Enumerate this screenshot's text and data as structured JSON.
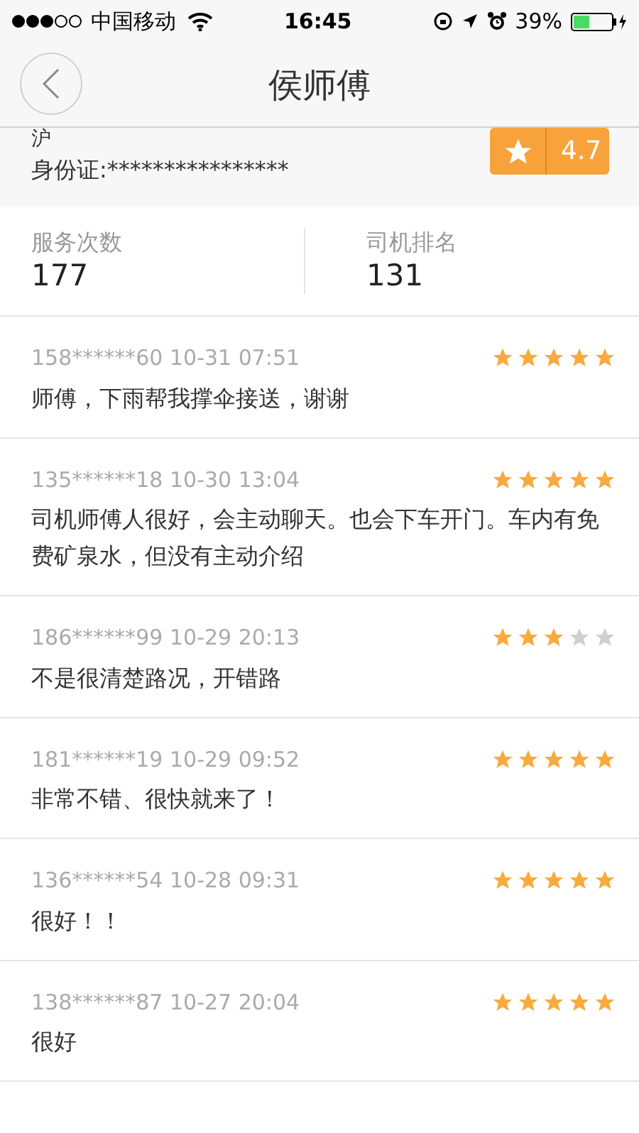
{
  "status_bar": {
    "carrier": "中国移动",
    "time": "16:45",
    "battery": "39%"
  },
  "header": {
    "title": "侯师傅"
  },
  "profile": {
    "plate": "沪",
    "id_card": "身份证:****************",
    "rating": "4.7"
  },
  "stats": [
    {
      "label": "服务次数",
      "value": "177"
    },
    {
      "label": "司机排名",
      "value": "131"
    }
  ],
  "reviews": [
    {
      "meta": "158******60 10-31 07:51",
      "stars": 5,
      "text": "师傅，下雨帮我撑伞接送，谢谢"
    },
    {
      "meta": "135******18 10-30 13:04",
      "stars": 5,
      "text": "司机师傅人很好，会主动聊天。也会下车开门。车内有免费矿泉水，但没有主动介绍"
    },
    {
      "meta": "186******99 10-29 20:13",
      "stars": 3,
      "text": "不是很清楚路况，开错路"
    },
    {
      "meta": "181******19 10-29 09:52",
      "stars": 5,
      "text": "非常不错、很快就来了！"
    },
    {
      "meta": "136******54 10-28 09:31",
      "stars": 5,
      "text": "很好！！"
    },
    {
      "meta": "138******87 10-27 20:04",
      "stars": 5,
      "text": "很好"
    }
  ]
}
